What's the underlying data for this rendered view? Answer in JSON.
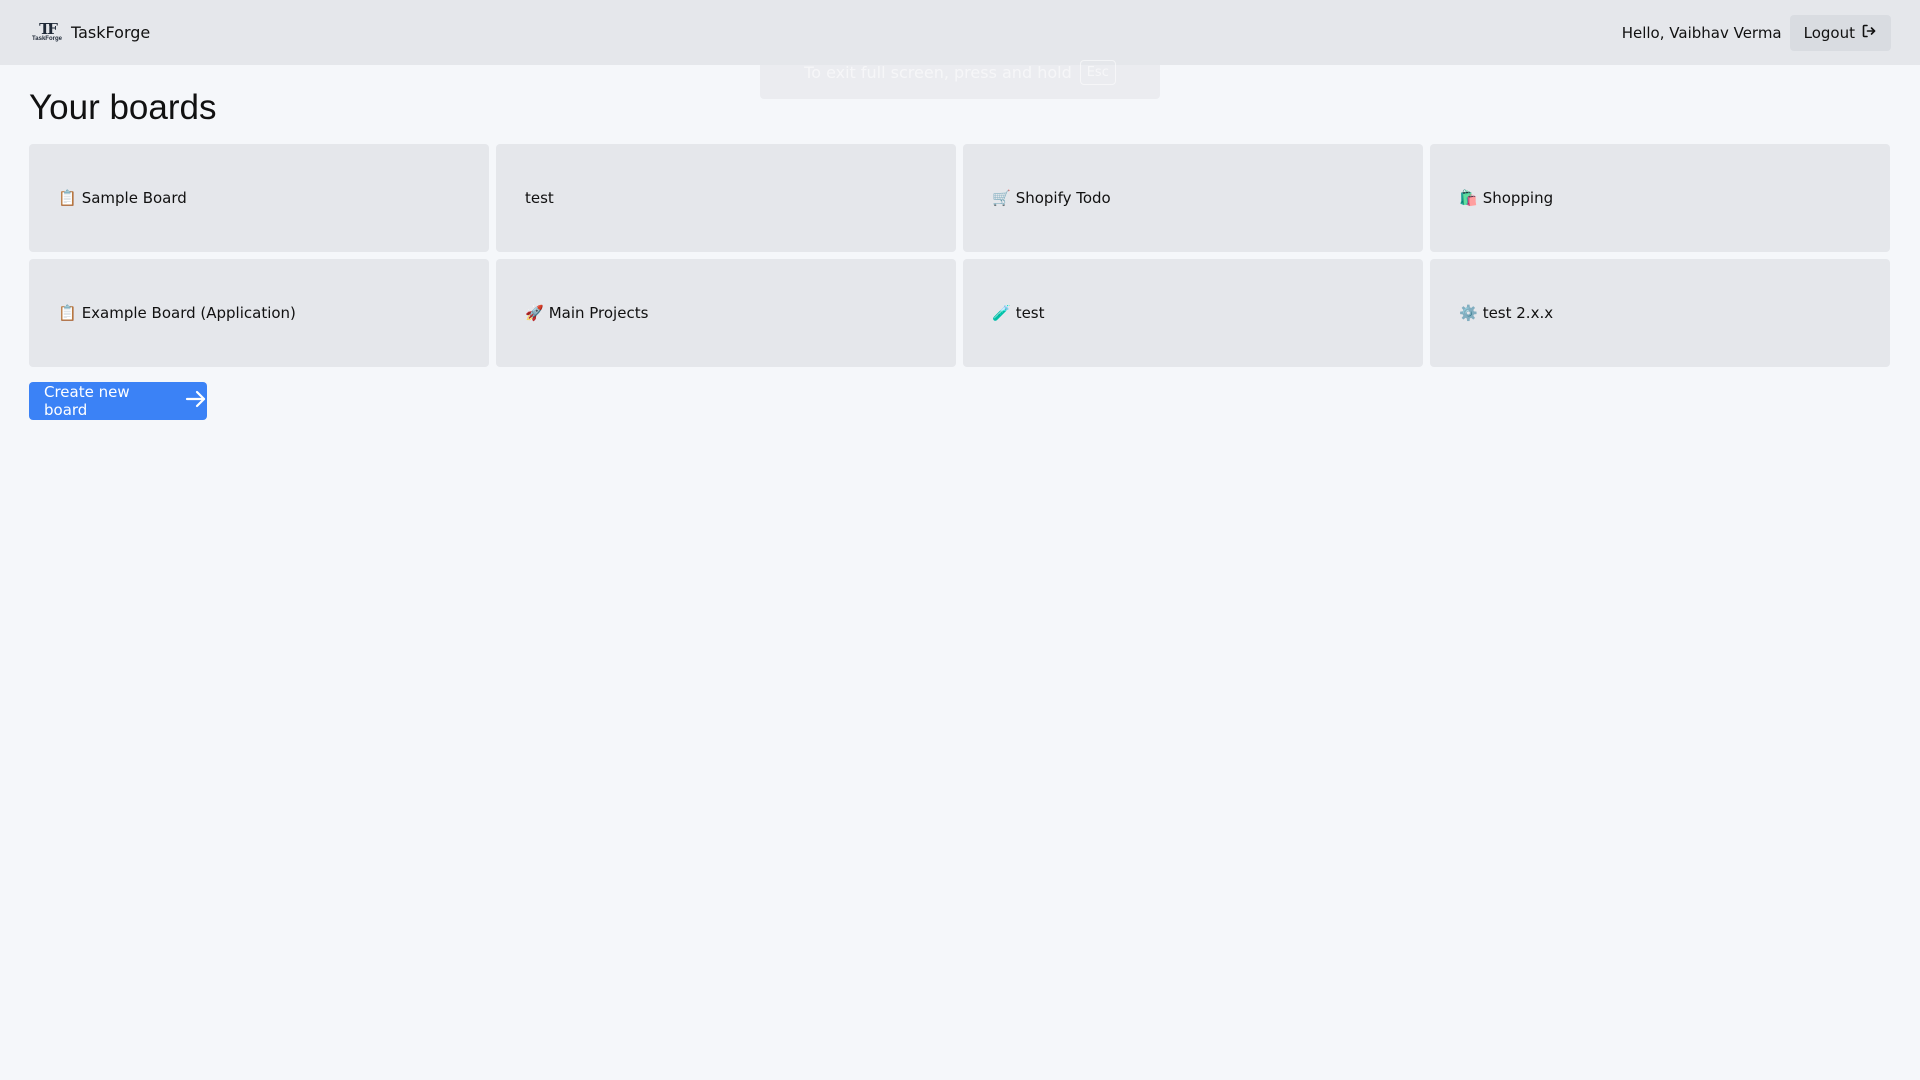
{
  "header": {
    "logo_mark": "TF",
    "logo_word": "TaskForge",
    "app_name": "TaskForge",
    "greeting": "Hello, Vaibhav Verma",
    "logout_label": "Logout"
  },
  "fullscreen_toast": {
    "text": "To exit full screen, press and hold",
    "key": "Esc"
  },
  "page": {
    "title": "Your boards"
  },
  "boards": [
    {
      "emoji": "📋",
      "name": "Sample Board"
    },
    {
      "emoji": "",
      "name": "test"
    },
    {
      "emoji": "🛒",
      "name": "Shopify Todo"
    },
    {
      "emoji": "🛍️",
      "name": "Shopping"
    },
    {
      "emoji": "📋",
      "name": "Example Board (Application)"
    },
    {
      "emoji": "🚀",
      "name": "Main Projects"
    },
    {
      "emoji": "🧪",
      "name": "test"
    },
    {
      "emoji": "⚙️",
      "name": "test 2.x.x"
    }
  ],
  "actions": {
    "create_label": "Create new board"
  },
  "colors": {
    "background": "#f5f7fa",
    "card": "#e5e7eb",
    "primary": "#3b82f6"
  },
  "icons": {
    "logout": "logout-icon",
    "create": "arrow-right-icon"
  }
}
